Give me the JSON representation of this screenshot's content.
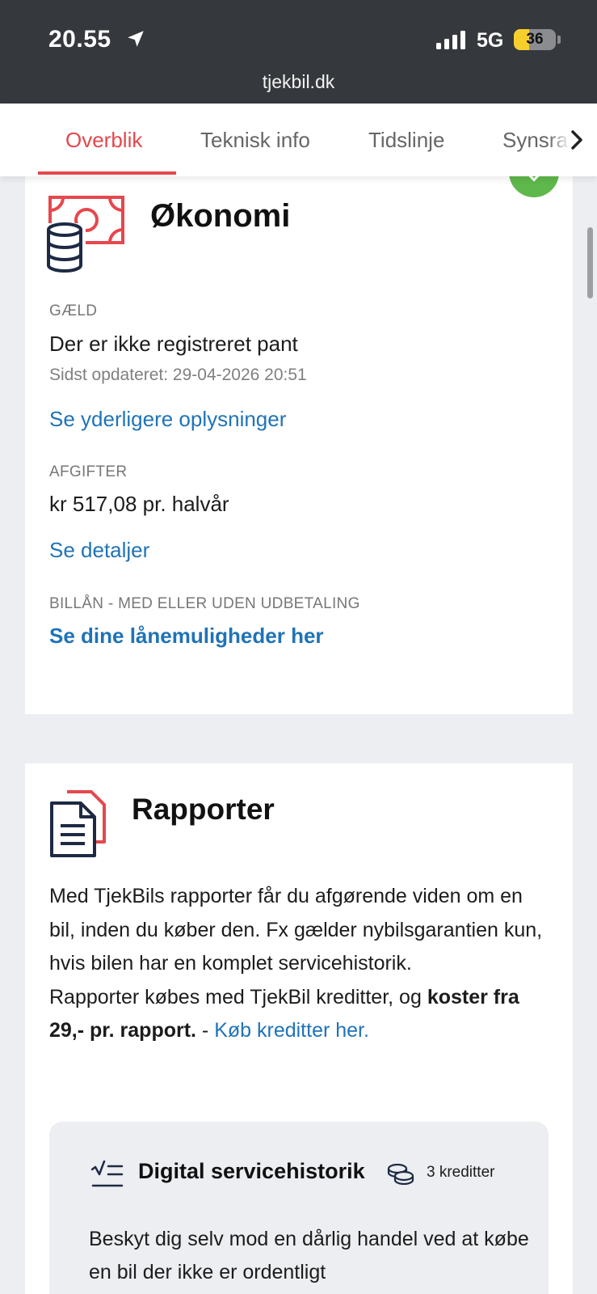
{
  "status_bar": {
    "time": "20.55",
    "network": "5G",
    "battery_level": "36",
    "battery_fraction": 0.36,
    "url": "tjekbil.dk"
  },
  "tabs": [
    {
      "label": "Overblik",
      "active": true
    },
    {
      "label": "Teknisk info",
      "active": false
    },
    {
      "label": "Tidslinje",
      "active": false
    },
    {
      "label": "Synsrapport",
      "active": false
    }
  ],
  "economy": {
    "title": "Økonomi",
    "debt_label": "GÆLD",
    "debt_value": "Der er ikke registreret pant",
    "debt_updated": "Sidst opdateret: 29-04-2026 20:51",
    "debt_link": "Se yderligere oplysninger",
    "fees_label": "AFGIFTER",
    "fees_value": "kr 517,08 pr. halvår",
    "fees_link": "Se detaljer",
    "loan_label": "BILLÅN - MED ELLER UDEN UDBETALING",
    "loan_link": "Se dine lånemuligheder her"
  },
  "reports": {
    "title": "Rapporter",
    "para_1": "Med TjekBils rapporter får du afgørende viden om en bil, inden du køber den. Fx gælder nybilsgarantien kun, hvis bilen har en komplet servicehistorik.",
    "para_2_pre": "Rapporter købes med TjekBil kreditter, og ",
    "para_2_bold": "koster fra 29,- pr. rapport.",
    "para_2_sep": " - ",
    "para_2_link": "Køb kreditter her.",
    "item": {
      "title": "Digital servicehistorik",
      "credits": "3 kreditter",
      "description": "Beskyt dig selv mod en dårlig handel ved at købe en bil der ikke er ordentligt"
    }
  },
  "colors": {
    "accent_red": "#e5484d",
    "link_blue": "#1f73b7",
    "status_bg": "#35383c",
    "success_green": "#5fb84b"
  }
}
